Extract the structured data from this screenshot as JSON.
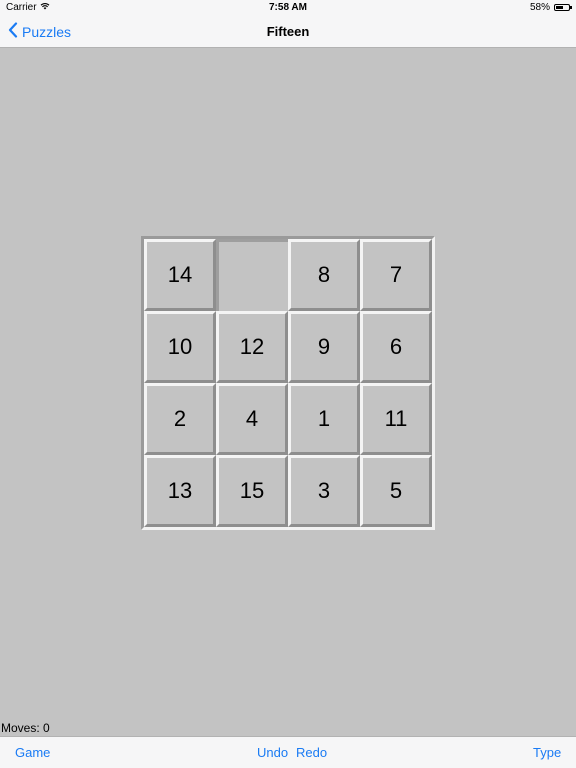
{
  "status_bar": {
    "carrier": "Carrier",
    "time": "7:58 AM",
    "battery_percent": "58%",
    "battery_level": 0.58
  },
  "nav": {
    "back_label": "Puzzles",
    "title": "Fifteen"
  },
  "board": {
    "rows": 4,
    "cols": 4,
    "tiles": [
      [
        "14",
        "",
        "8",
        "7"
      ],
      [
        "10",
        "12",
        "9",
        "6"
      ],
      [
        "2",
        "4",
        "1",
        "11"
      ],
      [
        "13",
        "15",
        "3",
        "5"
      ]
    ]
  },
  "status": {
    "moves": "Moves: 0"
  },
  "toolbar": {
    "game_label": "Game",
    "undo_label": "Undo",
    "redo_label": "Redo",
    "type_label": "Type"
  },
  "colors": {
    "accent": "#1a7bf4",
    "background": "#c3c3c3",
    "bar_background": "#f6f6f7"
  }
}
